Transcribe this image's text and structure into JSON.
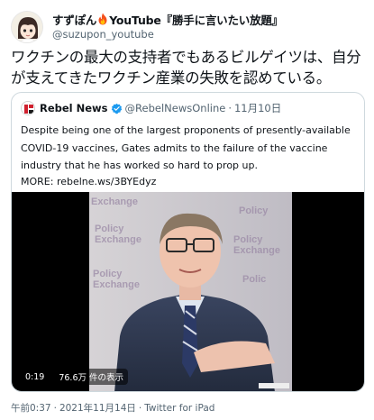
{
  "author": {
    "display_name_prefix": "すずぽん",
    "display_name_suffix": "YouTube『勝手に言いたい放題』",
    "handle": "@suzupon_youtube",
    "avatar_icon": "anime-avatar-icon",
    "name_emoji": "fire-icon"
  },
  "tweet": {
    "text": "ワクチンの最大の支持者でもあるビルゲイツは、自分が支えてきたワクチン産業の失敗を認めている。"
  },
  "quoted": {
    "name": "Rebel News",
    "handle": "@RebelNewsOnline",
    "separator": "·",
    "date": "11月10日",
    "body": "Despite being one of the largest proponents of presently-available COVID-19 vaccines, Gates admits to the failure of the vaccine industry that he has worked so hard to prop up.",
    "more": "MORE: rebelne.ws/3BYEdyz",
    "avatar_icon": "rebel-news-logo-icon",
    "verified_icon": "verified-badge-icon",
    "verified_color": "#1d9bf0"
  },
  "video": {
    "time": "0:19",
    "views": "76.6万 件の表示",
    "backdrop_text": "Policy Exchange"
  },
  "footer": {
    "time": "午前0:37",
    "separator": "·",
    "date": "2021年11月14日",
    "source": "Twitter for iPad"
  },
  "colors": {
    "text": "#0f1419",
    "secondary": "#536471",
    "border": "#cfd9de",
    "rebel_red": "#d0202e"
  }
}
